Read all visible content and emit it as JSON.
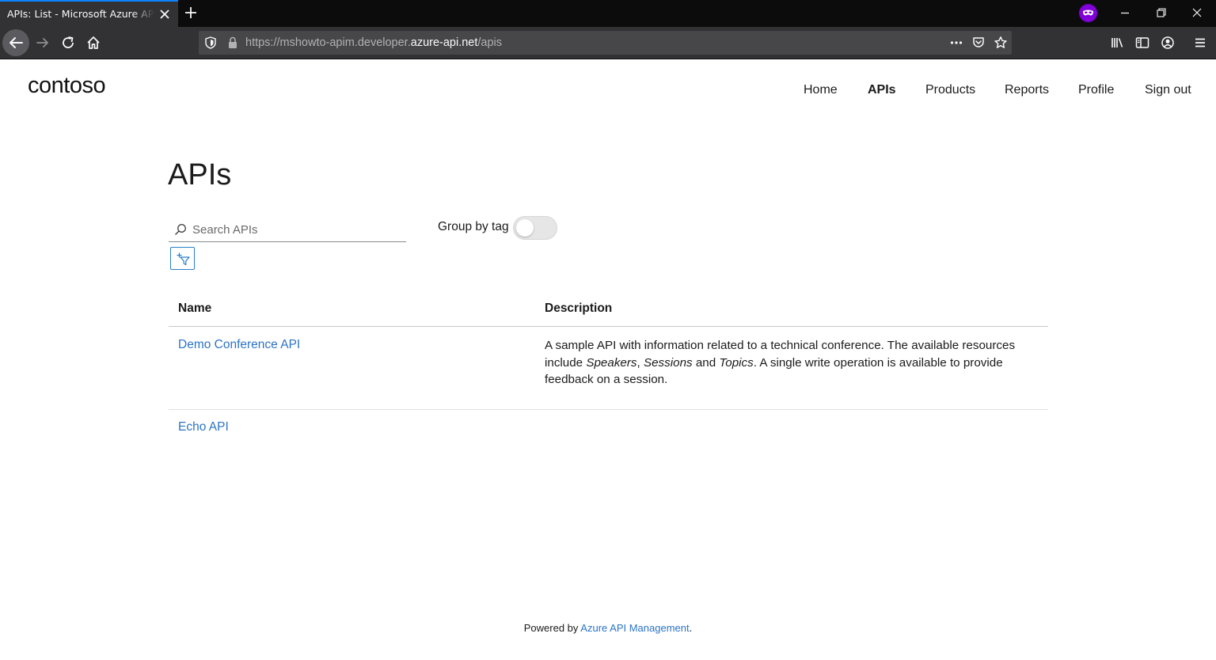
{
  "browser": {
    "tab_title": "APIs: List - Microsoft Azure API Management",
    "url": {
      "prefix": "https://mshowto-apim.developer.",
      "host": "azure-api.net",
      "path": "/apis"
    }
  },
  "header": {
    "logo": "contoso",
    "nav": [
      {
        "label": "Home",
        "active": false
      },
      {
        "label": "APIs",
        "active": true
      },
      {
        "label": "Products",
        "active": false
      },
      {
        "label": "Reports",
        "active": false
      },
      {
        "label": "Profile",
        "active": false
      },
      {
        "label": "Sign out",
        "active": false
      }
    ]
  },
  "main": {
    "title": "APIs",
    "search": {
      "placeholder": "Search APIs",
      "value": ""
    },
    "group_by_tag": {
      "label": "Group by tag",
      "enabled": false
    },
    "table": {
      "columns": [
        "Name",
        "Description"
      ],
      "rows": [
        {
          "name": "Demo Conference API",
          "description": {
            "p1": "A sample API with information related to a technical conference. The available resources include ",
            "e1": "Speakers",
            "p2": ", ",
            "e2": "Sessions",
            "p3": " and ",
            "e3": "Topics",
            "p4": ". A single write operation is available to provide feedback on a session."
          }
        },
        {
          "name": "Echo API",
          "description": null
        }
      ]
    }
  },
  "footer": {
    "prefix": "Powered by ",
    "link": "Azure API Management",
    "suffix": "."
  },
  "colors": {
    "link": "#2b74c4",
    "private_badge": "#8000d7",
    "tab_accent": "#0a84ff"
  }
}
